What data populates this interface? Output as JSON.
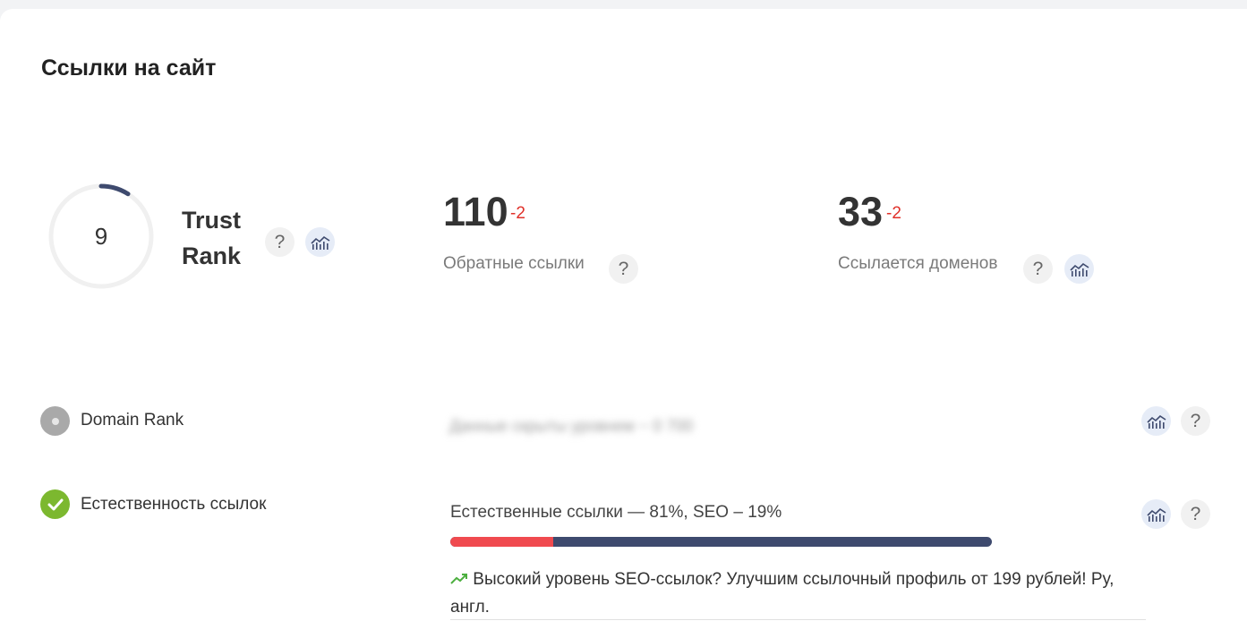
{
  "section": {
    "title": "Ссылки на сайт"
  },
  "trust_rank": {
    "value": "9",
    "fraction": 0.09,
    "label": "Trust Rank",
    "arc_color": "#3e4a6e",
    "track_color": "#f0f0f0"
  },
  "backlinks": {
    "value": "110",
    "delta": "-2",
    "label": "Обратные ссылки"
  },
  "domains": {
    "value": "33",
    "delta": "-2",
    "label": "Ссылается доменов"
  },
  "domain_rank": {
    "label": "Domain Rank",
    "blurred_text": "Данные скрыты уровнем ~ 0 700",
    "status": "neutral",
    "status_color": "#a9a9a9"
  },
  "naturalness": {
    "label": "Естественность ссылок",
    "status": "ok",
    "status_color": "#7cb82f",
    "ratio_text": "Естественные ссылки — 81%, SEO – 19%",
    "natural_percent": 81,
    "seo_percent": 19,
    "natural_color": "#3e4a6e",
    "seo_color": "#f04a4f",
    "promo_text": "Высокий уровень SEO-ссылок? Улучшим ссылочный профиль от 199 рублей! Ру, англ."
  },
  "icons": {
    "help": "question-mark-icon",
    "chart": "chart-icon",
    "trend": "trend-up-icon",
    "check": "check-icon",
    "dot": "dot-icon"
  },
  "help_glyph": "?"
}
